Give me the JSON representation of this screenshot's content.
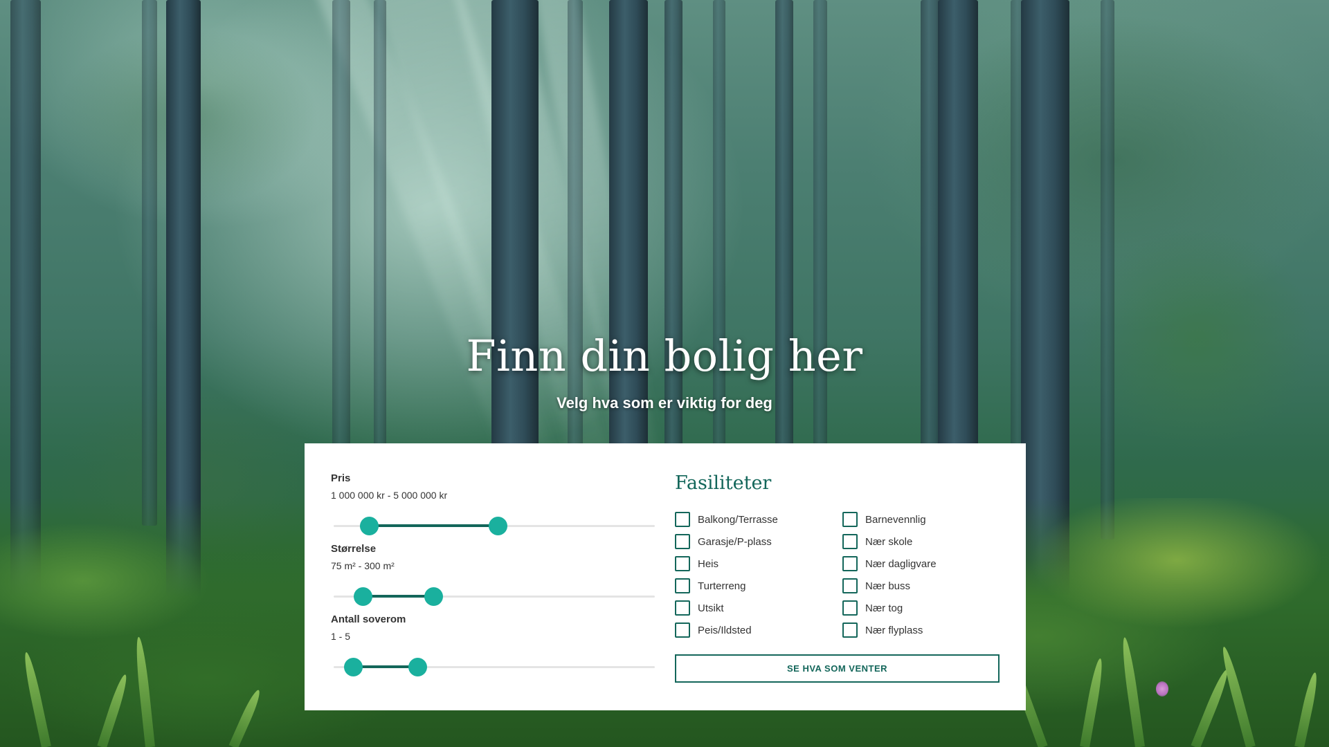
{
  "hero": {
    "title": "Finn din bolig her",
    "subtitle": "Velg hva som er viktig for deg"
  },
  "filters": [
    {
      "label": "Pris",
      "value": "1 000 000 kr - 5 000 000 kr",
      "range_start_pct": 11,
      "range_end_pct": 51
    },
    {
      "label": "Størrelse",
      "value": "75 m² - 300 m²",
      "range_start_pct": 9,
      "range_end_pct": 31
    },
    {
      "label": "Antall soverom",
      "value": "1 - 5",
      "range_start_pct": 6,
      "range_end_pct": 26
    }
  ],
  "amenities": {
    "title": "Fasiliteter",
    "left": [
      {
        "label": "Balkong/Terrasse",
        "checked": false
      },
      {
        "label": "Garasje/P-plass",
        "checked": false
      },
      {
        "label": "Heis",
        "checked": false
      },
      {
        "label": "Turterreng",
        "checked": false
      },
      {
        "label": "Utsikt",
        "checked": false
      },
      {
        "label": "Peis/Ildsted",
        "checked": false
      }
    ],
    "right": [
      {
        "label": "Barnevennlig",
        "checked": false
      },
      {
        "label": "Nær skole",
        "checked": false
      },
      {
        "label": "Nær dagligvare",
        "checked": false
      },
      {
        "label": "Nær buss",
        "checked": false
      },
      {
        "label": "Nær tog",
        "checked": false
      },
      {
        "label": "Nær flyplass",
        "checked": false
      }
    ]
  },
  "cta": {
    "label": "SE HVA SOM VENTER"
  },
  "colors": {
    "accent": "#13665a",
    "slider_thumb": "#1ab09e",
    "card_bg": "#ffffff",
    "text": "#333333"
  }
}
